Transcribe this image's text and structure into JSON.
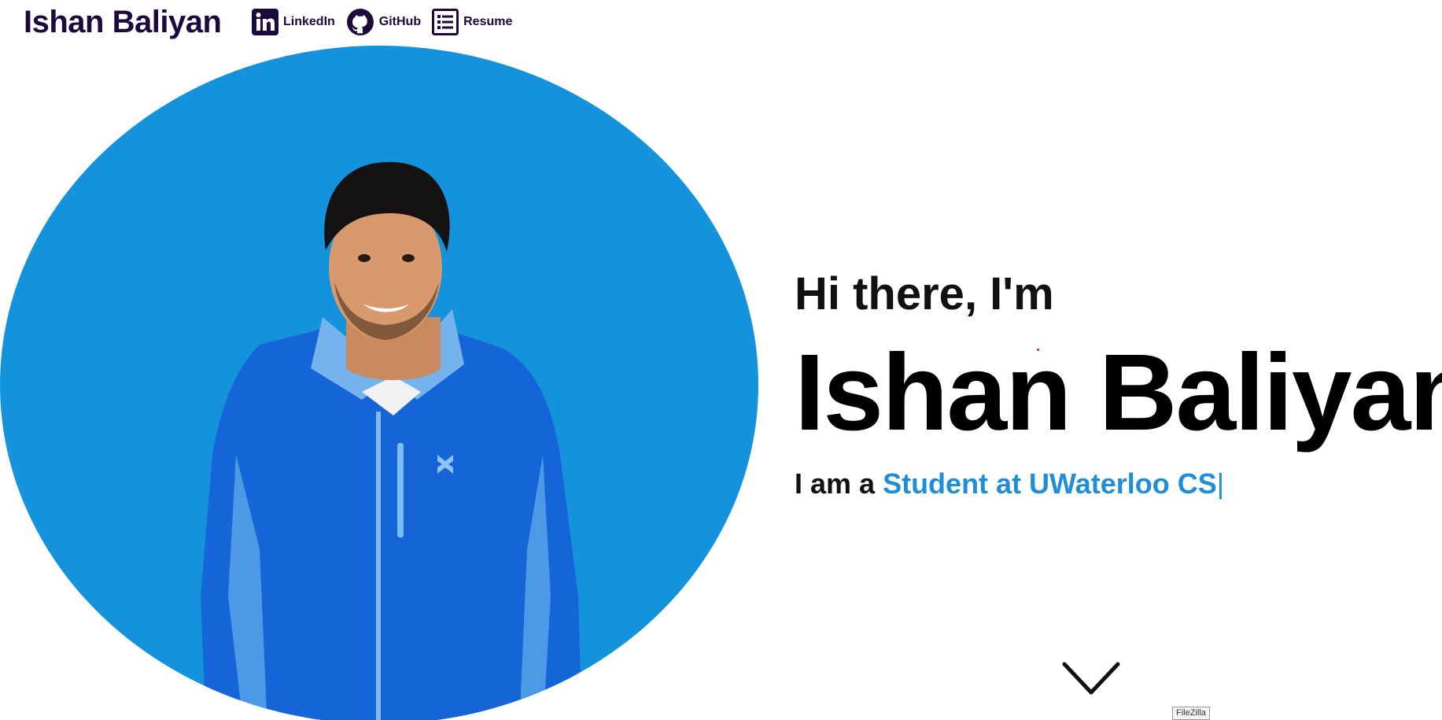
{
  "header": {
    "brand": "Ishan Baliyan",
    "links": [
      {
        "label": "LinkedIn",
        "icon": "linkedin-icon"
      },
      {
        "label": "GitHub",
        "icon": "github-icon"
      },
      {
        "label": "Resume",
        "icon": "list-document-icon"
      }
    ]
  },
  "hero": {
    "greeting": "Hi there, I'm",
    "name": "Ishan Baliyan",
    "role_prefix": "I am a ",
    "role_typed": "Student at UWaterloo CS",
    "cursor": "|",
    "scroll_icon": "chevron-down-icon"
  },
  "tooltip": "FileZilla",
  "colors": {
    "brand_text": "#1c0a3d",
    "hero_circle": "#1492dc",
    "accent": "#1e8ed8",
    "jacket": "#1565d8"
  }
}
